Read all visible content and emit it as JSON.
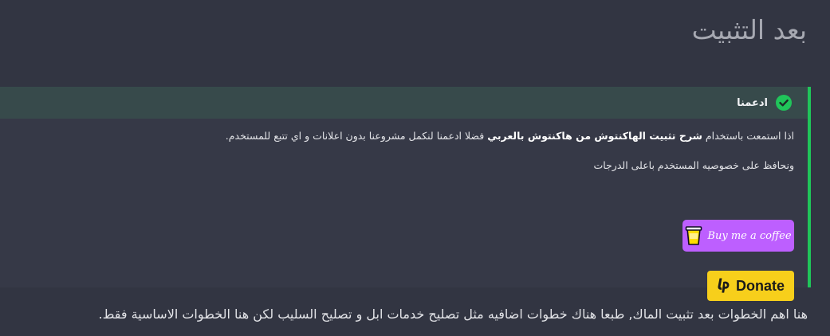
{
  "heading": "بعد التثبيت",
  "support_box": {
    "title": "ادعمنا",
    "para1": {
      "before": "اذا استمعت باستخدام ",
      "bold": "شرح تثبيت الهاكنتوش من هاكنتوش بالعربي",
      "after": " فضلا ادعمنا لنكمل مشروعنا بدون اعلانات و اي تتبع للمستخدم."
    },
    "para2": "ونحافظ على خصوصيه المستخدم باعلى الدرجات",
    "bmc_label": "Buy me a coffee",
    "donate_label": "Donate",
    "colors": {
      "accent_green": "#20c55a",
      "bmc_purple": "#bd5fff",
      "donate_yellow": "#f7cf1b"
    }
  },
  "footer_text": "هنا اهم الخطوات بعد تثبيت الماك, طبعا هناك خطوات اضافيه مثل تصليح خدمات ابل و تصليح السليب لكن هنا الخطوات الاساسية فقط."
}
